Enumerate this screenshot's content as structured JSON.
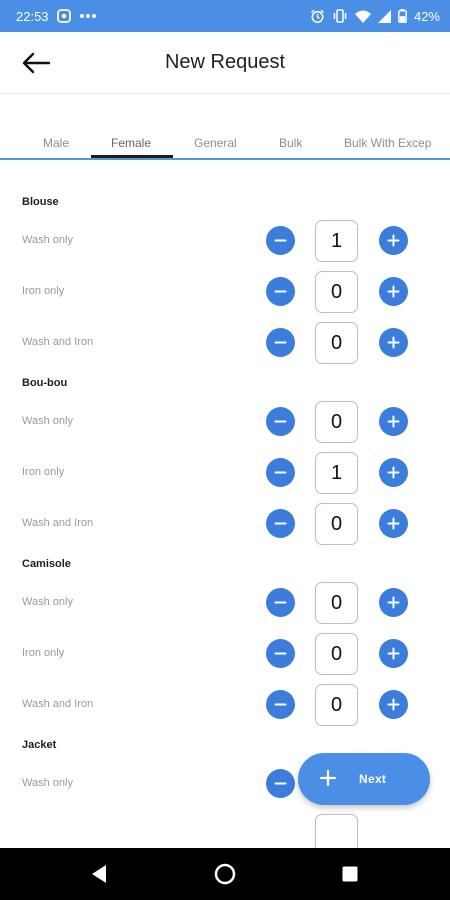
{
  "status_bar": {
    "time": "22:53",
    "battery": "42%",
    "left_icons": [
      "app-notification-icon",
      "more-dots-icon"
    ],
    "right_icons": [
      "alarm-icon",
      "vibrate-icon",
      "wifi-icon",
      "signal-icon",
      "battery-icon"
    ]
  },
  "app_bar": {
    "title": "New Request"
  },
  "tabs": [
    {
      "label": "Male",
      "active": false
    },
    {
      "label": "Female",
      "active": true
    },
    {
      "label": "General",
      "active": false
    },
    {
      "label": "Bulk",
      "active": false
    },
    {
      "label": "Bulk With Excep",
      "active": false
    }
  ],
  "sections": [
    {
      "title": "Blouse",
      "rows": [
        {
          "label": "Wash only",
          "qty": "1"
        },
        {
          "label": "Iron only",
          "qty": "0"
        },
        {
          "label": "Wash and Iron",
          "qty": "0"
        }
      ]
    },
    {
      "title": "Bou-bou",
      "rows": [
        {
          "label": "Wash only",
          "qty": "0"
        },
        {
          "label": "Iron only",
          "qty": "1"
        },
        {
          "label": "Wash and Iron",
          "qty": "0"
        }
      ]
    },
    {
      "title": "Camisole",
      "rows": [
        {
          "label": "Wash only",
          "qty": "0"
        },
        {
          "label": "Iron only",
          "qty": "0"
        },
        {
          "label": "Wash and Iron",
          "qty": "0"
        }
      ]
    },
    {
      "title": "Jacket",
      "rows": [
        {
          "label": "Wash only",
          "qty": ""
        }
      ]
    }
  ],
  "fab": {
    "label": "Next"
  },
  "colors": {
    "accent": "#3c7ddc",
    "status_bar": "#4a8ee6",
    "nav_bar": "#000000"
  }
}
